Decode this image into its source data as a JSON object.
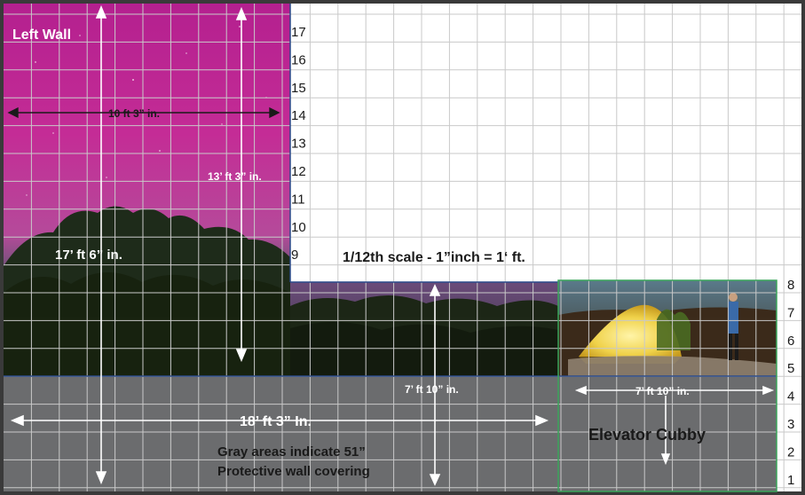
{
  "labels": {
    "left_wall": "Left Wall",
    "dim_10ft_3in": "10 ft 3” in.",
    "dim_13ft_3in": "13’ ft 3” in.",
    "dim_17ft_6in": "17’ ft 6” in.",
    "scale_note": "1/12th scale - 1”inch = 1‘ ft.",
    "dim_18ft_3in": "18’ ft 3” In.",
    "dim_7ft_10in_center": "7’ ft 10” in.",
    "dim_7ft_10in_cubby": "7’ ft 10” in.",
    "elevator_cubby": "Elevator Cubby",
    "gray_note_line1": "Gray areas indicate 51”",
    "gray_note_line2": "Protective wall covering"
  },
  "row_numbers_mid": [
    "17",
    "16",
    "15",
    "14",
    "13",
    "12",
    "11",
    "10",
    "9"
  ],
  "row_numbers_right": [
    "8",
    "7",
    "6",
    "5",
    "4",
    "3",
    "2",
    "1"
  ],
  "colors": {
    "aurora_magenta": "#b4208f",
    "aurora_pink": "#d23a9f",
    "night_teal": "#2f5a52",
    "trees": "#1e2b1a",
    "protective_gray": "#6b6c6e",
    "tent_yellow": "#f0d24a",
    "grid_line": "#c9c9c9",
    "cubby_border": "#3aa55a",
    "label_dark": "#1a1a1a",
    "label_light": "#ffffff"
  }
}
